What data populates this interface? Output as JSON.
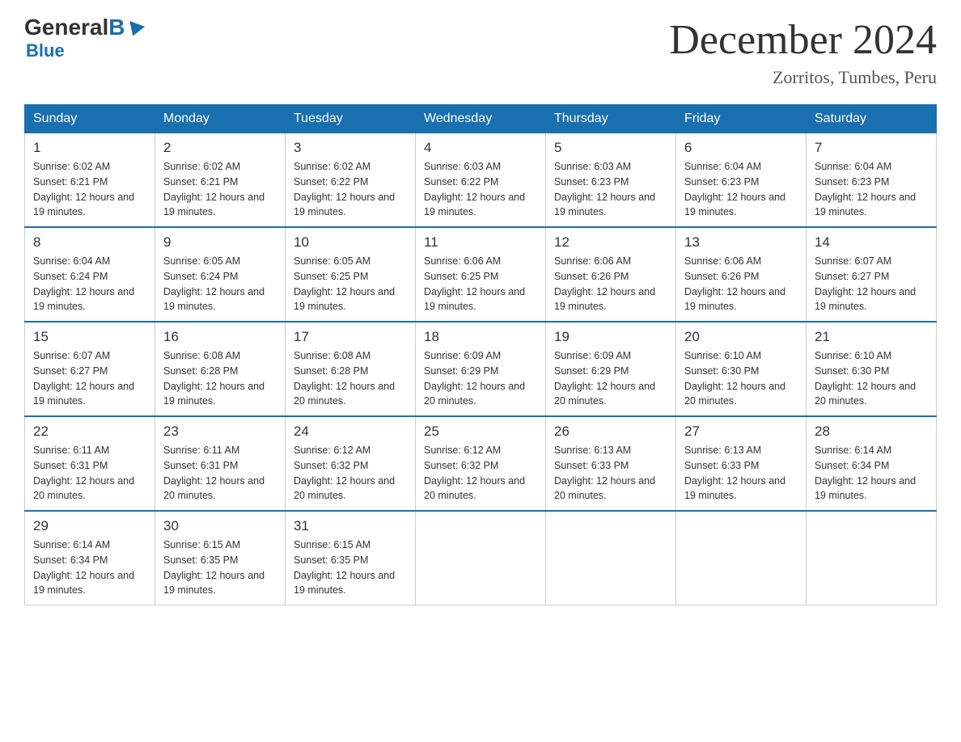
{
  "logo": {
    "general": "General",
    "blue": "Blue",
    "subtitle": "Blue"
  },
  "title": "December 2024",
  "subtitle": "Zorritos, Tumbes, Peru",
  "days_of_week": [
    "Sunday",
    "Monday",
    "Tuesday",
    "Wednesday",
    "Thursday",
    "Friday",
    "Saturday"
  ],
  "weeks": [
    [
      {
        "day": "1",
        "sunrise": "6:02 AM",
        "sunset": "6:21 PM",
        "daylight": "12 hours and 19 minutes."
      },
      {
        "day": "2",
        "sunrise": "6:02 AM",
        "sunset": "6:21 PM",
        "daylight": "12 hours and 19 minutes."
      },
      {
        "day": "3",
        "sunrise": "6:02 AM",
        "sunset": "6:22 PM",
        "daylight": "12 hours and 19 minutes."
      },
      {
        "day": "4",
        "sunrise": "6:03 AM",
        "sunset": "6:22 PM",
        "daylight": "12 hours and 19 minutes."
      },
      {
        "day": "5",
        "sunrise": "6:03 AM",
        "sunset": "6:23 PM",
        "daylight": "12 hours and 19 minutes."
      },
      {
        "day": "6",
        "sunrise": "6:04 AM",
        "sunset": "6:23 PM",
        "daylight": "12 hours and 19 minutes."
      },
      {
        "day": "7",
        "sunrise": "6:04 AM",
        "sunset": "6:23 PM",
        "daylight": "12 hours and 19 minutes."
      }
    ],
    [
      {
        "day": "8",
        "sunrise": "6:04 AM",
        "sunset": "6:24 PM",
        "daylight": "12 hours and 19 minutes."
      },
      {
        "day": "9",
        "sunrise": "6:05 AM",
        "sunset": "6:24 PM",
        "daylight": "12 hours and 19 minutes."
      },
      {
        "day": "10",
        "sunrise": "6:05 AM",
        "sunset": "6:25 PM",
        "daylight": "12 hours and 19 minutes."
      },
      {
        "day": "11",
        "sunrise": "6:06 AM",
        "sunset": "6:25 PM",
        "daylight": "12 hours and 19 minutes."
      },
      {
        "day": "12",
        "sunrise": "6:06 AM",
        "sunset": "6:26 PM",
        "daylight": "12 hours and 19 minutes."
      },
      {
        "day": "13",
        "sunrise": "6:06 AM",
        "sunset": "6:26 PM",
        "daylight": "12 hours and 19 minutes."
      },
      {
        "day": "14",
        "sunrise": "6:07 AM",
        "sunset": "6:27 PM",
        "daylight": "12 hours and 19 minutes."
      }
    ],
    [
      {
        "day": "15",
        "sunrise": "6:07 AM",
        "sunset": "6:27 PM",
        "daylight": "12 hours and 19 minutes."
      },
      {
        "day": "16",
        "sunrise": "6:08 AM",
        "sunset": "6:28 PM",
        "daylight": "12 hours and 19 minutes."
      },
      {
        "day": "17",
        "sunrise": "6:08 AM",
        "sunset": "6:28 PM",
        "daylight": "12 hours and 20 minutes."
      },
      {
        "day": "18",
        "sunrise": "6:09 AM",
        "sunset": "6:29 PM",
        "daylight": "12 hours and 20 minutes."
      },
      {
        "day": "19",
        "sunrise": "6:09 AM",
        "sunset": "6:29 PM",
        "daylight": "12 hours and 20 minutes."
      },
      {
        "day": "20",
        "sunrise": "6:10 AM",
        "sunset": "6:30 PM",
        "daylight": "12 hours and 20 minutes."
      },
      {
        "day": "21",
        "sunrise": "6:10 AM",
        "sunset": "6:30 PM",
        "daylight": "12 hours and 20 minutes."
      }
    ],
    [
      {
        "day": "22",
        "sunrise": "6:11 AM",
        "sunset": "6:31 PM",
        "daylight": "12 hours and 20 minutes."
      },
      {
        "day": "23",
        "sunrise": "6:11 AM",
        "sunset": "6:31 PM",
        "daylight": "12 hours and 20 minutes."
      },
      {
        "day": "24",
        "sunrise": "6:12 AM",
        "sunset": "6:32 PM",
        "daylight": "12 hours and 20 minutes."
      },
      {
        "day": "25",
        "sunrise": "6:12 AM",
        "sunset": "6:32 PM",
        "daylight": "12 hours and 20 minutes."
      },
      {
        "day": "26",
        "sunrise": "6:13 AM",
        "sunset": "6:33 PM",
        "daylight": "12 hours and 20 minutes."
      },
      {
        "day": "27",
        "sunrise": "6:13 AM",
        "sunset": "6:33 PM",
        "daylight": "12 hours and 19 minutes."
      },
      {
        "day": "28",
        "sunrise": "6:14 AM",
        "sunset": "6:34 PM",
        "daylight": "12 hours and 19 minutes."
      }
    ],
    [
      {
        "day": "29",
        "sunrise": "6:14 AM",
        "sunset": "6:34 PM",
        "daylight": "12 hours and 19 minutes."
      },
      {
        "day": "30",
        "sunrise": "6:15 AM",
        "sunset": "6:35 PM",
        "daylight": "12 hours and 19 minutes."
      },
      {
        "day": "31",
        "sunrise": "6:15 AM",
        "sunset": "6:35 PM",
        "daylight": "12 hours and 19 minutes."
      },
      null,
      null,
      null,
      null
    ]
  ]
}
